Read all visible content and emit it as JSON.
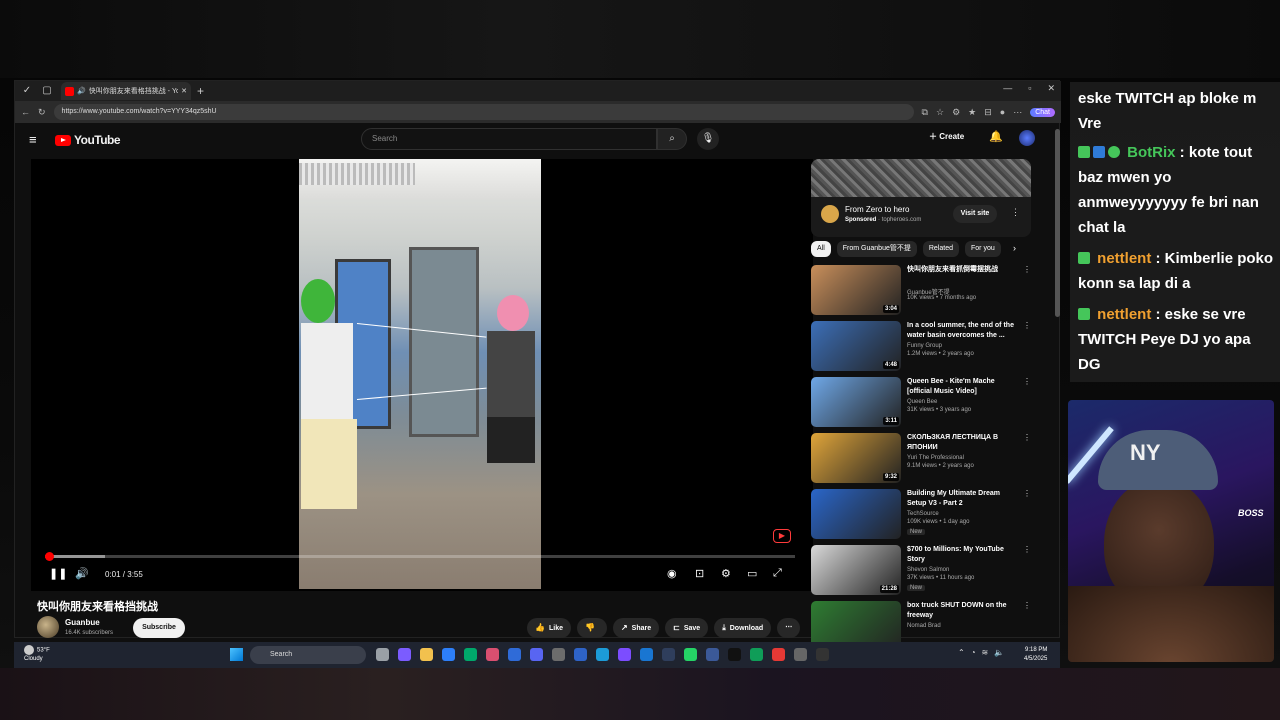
{
  "browser": {
    "tab_title": "快叫你朋友来看格挡挑战 - Yo",
    "url": "https://www.youtube.com/watch?v=YYY34qz5shU",
    "chat_label": "Chat"
  },
  "youtube": {
    "logo_text": "YouTube",
    "search_placeholder": "Search",
    "create_label": "Create"
  },
  "player": {
    "time": "0:01 / 3:55",
    "progress_fraction": 0.005,
    "buffer_fraction": 0.08
  },
  "video": {
    "title": "快叫你朋友来看格挡挑战",
    "channel": "Guanbue",
    "subscribers": "16.4K subscribers",
    "subscribe_label": "Subscribe",
    "actions": {
      "like": "Like",
      "share": "Share",
      "save": "Save",
      "download": "Download"
    }
  },
  "ad": {
    "title": "From Zero to hero",
    "sponsored": "Sponsored",
    "domain": "topheroes.com",
    "visit_label": "Visit site"
  },
  "chips": [
    "All",
    "From Guanbue管不提",
    "Related",
    "For you"
  ],
  "recommendations": [
    {
      "title": "快叫你朋友来看抓倒霉摆挑战",
      "channel": "Guanbue管不提",
      "meta": "10K views • 7 months ago",
      "duration": "3:04",
      "badge": "",
      "thumb_color": "#c98f5b"
    },
    {
      "title": "In a cool summer, the end of the water basin overcomes the ...",
      "channel": "Funny Group",
      "meta": "1.2M views • 2 years ago",
      "duration": "4:48",
      "badge": "",
      "thumb_color": "#3c6fb8"
    },
    {
      "title": "Queen Bee - Kite'm Mache [official Music Video]",
      "channel": "Queen Bee",
      "meta": "31K views • 3 years ago",
      "duration": "3:11",
      "badge": "",
      "thumb_color": "#6fa8e8"
    },
    {
      "title": "СКОЛЬЗКАЯ ЛЕСТНИЦА В ЯПОНИИ",
      "channel": "Yuri The Professional",
      "meta": "9.1M views • 2 years ago",
      "duration": "9:32",
      "badge": "",
      "thumb_color": "#e0a53a"
    },
    {
      "title": "Building My Ultimate Dream Setup V3 - Part 2",
      "channel": "TechSource",
      "meta": "109K views • 1 day ago",
      "duration": "",
      "badge": "New",
      "thumb_color": "#2a66c9"
    },
    {
      "title": "$700 to Millions: My YouTube Story",
      "channel": "Shevon Salmon",
      "meta": "37K views • 11 hours ago",
      "duration": "21:28",
      "badge": "New",
      "thumb_color": "#d9d9d9"
    },
    {
      "title": "box truck SHUT DOWN on the freeway",
      "channel": "Nomad Brad",
      "meta": "",
      "duration": "",
      "badge": "",
      "thumb_color": "#2e7d32"
    }
  ],
  "taskbar": {
    "temp": "53°F",
    "weather": "Cloudy",
    "search_label": "Search",
    "time": "9:18 PM",
    "date": "4/5/2025"
  },
  "chat": {
    "messages": [
      {
        "user": "",
        "text": "eske TWITCH ap bloke m Vre",
        "user_color": ""
      },
      {
        "user": "BotRix",
        "text": " : kote tout baz mwen yo anmweyyyyyyy fe bri nan chat la",
        "user_color": "#45c65a"
      },
      {
        "user": "nettlent",
        "text": " : Kimberlie poko konn sa lap di a",
        "user_color": "#f0a030"
      },
      {
        "user": "nettlent",
        "text": " : eske se vre TWITCH Peye DJ yo apa DG",
        "user_color": "#f0a030"
      }
    ]
  },
  "webcam": {
    "cap_logo": "NY",
    "shirt_text": "BOSS"
  }
}
